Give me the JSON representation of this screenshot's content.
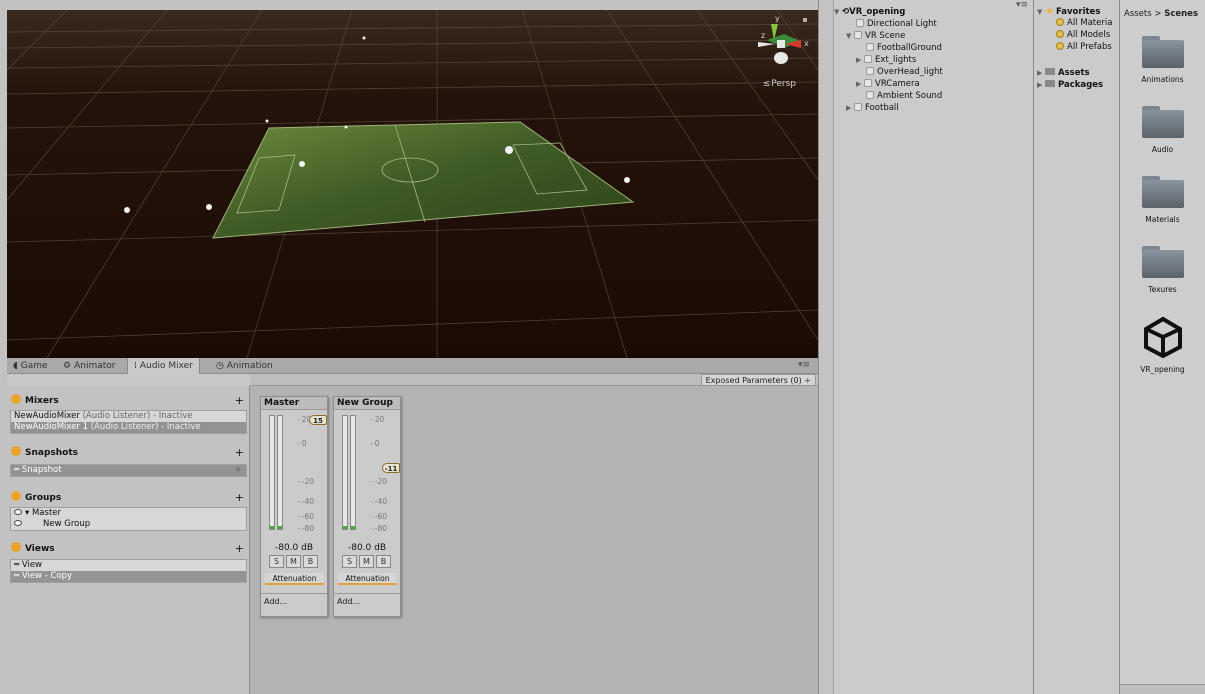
{
  "scene": {
    "persp_label": "Persp"
  },
  "tabs": [
    {
      "label": "Game",
      "icon": "game-icon"
    },
    {
      "label": "Animator",
      "icon": "animator-icon"
    },
    {
      "label": "Audio Mixer",
      "icon": "audio-mixer-icon",
      "active": true
    },
    {
      "label": "Animation",
      "icon": "animation-icon"
    }
  ],
  "exposed_params": "Exposed Parameters (0) ÷",
  "mixers": {
    "title": "Mixers",
    "items": [
      {
        "name": "NewAudioMixer",
        "detail": "(Audio Listener) - Inactive"
      },
      {
        "name": "NewAudioMixer 1",
        "detail": "(Audio Listener) - Inactive",
        "selected": true
      }
    ]
  },
  "snapshots": {
    "title": "Snapshots",
    "items": [
      "Snapshot"
    ]
  },
  "groups": {
    "title": "Groups",
    "items": [
      "Master",
      "New Group"
    ]
  },
  "views": {
    "title": "Views",
    "items": [
      "View",
      "View - Copy"
    ]
  },
  "strips": [
    {
      "name": "Master",
      "fader": "15",
      "db": "-80.0 dB",
      "effect": "Attenuation",
      "add": "Add...",
      "ticks": [
        "20",
        "0",
        "-20",
        "-40",
        "-60",
        "-80"
      ]
    },
    {
      "name": "New Group",
      "fader": "-11",
      "db": "-80.0 dB",
      "effect": "Attenuation",
      "add": "Add...",
      "ticks": [
        "20",
        "0",
        "-20",
        "-40",
        "-60",
        "-80"
      ]
    }
  ],
  "smb": [
    "S",
    "M",
    "B"
  ],
  "hierarchy": {
    "root": "VR_opening",
    "items": [
      "Directional Light",
      "VR Scene",
      "FootballGround",
      "Ext_lights",
      "OverHead_light",
      "VRCamera",
      "Ambient Sound",
      "Football"
    ]
  },
  "favorites": {
    "title": "Favorites",
    "items": [
      "All Materia",
      "All Models",
      "All Prefabs"
    ],
    "roots": [
      "Assets",
      "Packages"
    ]
  },
  "assets": {
    "crumb_root": "Assets",
    "crumb_sep": ">",
    "crumb_current": "Scenes",
    "items": [
      "Animations",
      "Audio",
      "Materials",
      "Texures",
      "VR_opening"
    ]
  }
}
